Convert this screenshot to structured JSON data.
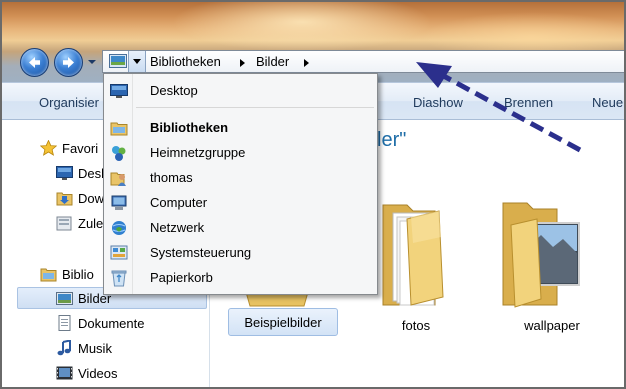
{
  "address_bar": {
    "crumbs": [
      "Bibliotheken",
      "Bilder"
    ]
  },
  "toolbar": {
    "organize": "Organisier",
    "slideshow": "Diashow",
    "burn": "Brennen",
    "new": "Neuer"
  },
  "nav_pane": {
    "favorites_label": "Favori",
    "favorites_items": [
      "Desl",
      "Dow",
      "Zule"
    ],
    "libraries_label": "Biblio",
    "library_items": [
      "Bilder",
      "Dokumente",
      "Musik",
      "Videos"
    ],
    "selected": "Bilder"
  },
  "content": {
    "library_title": "ler\"",
    "folders": [
      "Beispielbilder",
      "fotos",
      "wallpaper"
    ],
    "selected_folder": "Beispielbilder"
  },
  "menu": {
    "items": [
      {
        "label": "Desktop",
        "icon": "desktop-icon",
        "bold": false
      },
      {
        "label": "Bibliotheken",
        "icon": "libraries-icon",
        "bold": true
      },
      {
        "label": "Heimnetzgruppe",
        "icon": "homegroup-icon",
        "bold": false
      },
      {
        "label": "thomas",
        "icon": "user-folder-icon",
        "bold": false
      },
      {
        "label": "Computer",
        "icon": "computer-icon",
        "bold": false
      },
      {
        "label": "Netzwerk",
        "icon": "network-icon",
        "bold": false
      },
      {
        "label": "Systemsteuerung",
        "icon": "control-panel-icon",
        "bold": false
      },
      {
        "label": "Papierkorb",
        "icon": "recycle-bin-icon",
        "bold": false
      }
    ]
  },
  "annotation": {
    "arrow_color": "#2b2f8c"
  }
}
